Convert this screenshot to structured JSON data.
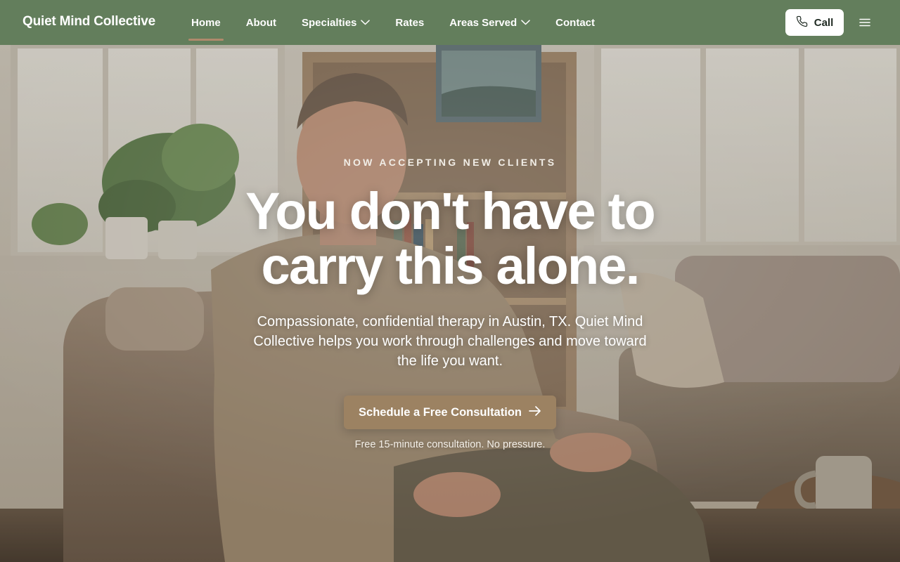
{
  "nav": {
    "brand": "Quiet Mind Collective",
    "links": [
      {
        "label": "Home",
        "active": true
      },
      {
        "label": "About"
      },
      {
        "label": "Specialties",
        "dropdown": true
      },
      {
        "label": "Rates"
      },
      {
        "label": "Areas Served",
        "dropdown": true
      },
      {
        "label": "Contact"
      }
    ],
    "call_label": "Call",
    "call_icon": "phone-icon",
    "menu_icon": "hamburger-menu-icon"
  },
  "hero": {
    "eyebrow": "NOW ACCEPTING NEW CLIENTS",
    "headline_line1": "You don't have to",
    "headline_line2": "carry this alone.",
    "description": "Compassionate, confidential therapy in Austin, TX. Quiet Mind Collective helps you work through challenges and move toward the life you want.",
    "cta_label": "Schedule a Free Consultation",
    "cta_icon": "arrow-right-icon",
    "note": "Free 15-minute consultation. No pressure."
  },
  "colors": {
    "nav_bg": "#637e5c",
    "active_underline": "#b08a6c",
    "cta_bg": "#9c8262"
  }
}
